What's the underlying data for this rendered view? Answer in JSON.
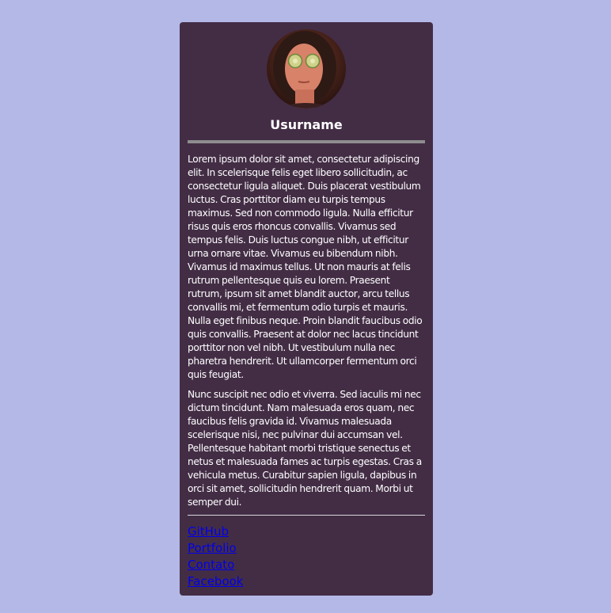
{
  "profile": {
    "username": "Usurname",
    "avatar_icon": "avatar-photo-cucumber-eyes",
    "bio": [
      "Lorem ipsum dolor sit amet, consectetur adipiscing elit. In scelerisque felis eget libero sollicitudin, ac consectetur ligula aliquet. Duis placerat vestibulum luctus. Cras porttitor diam eu turpis tempus maximus. Sed non commodo ligula. Nulla efficitur risus quis eros rhoncus convallis. Vivamus sed tempus felis. Duis luctus congue nibh, ut efficitur urna ornare vitae. Vivamus eu bibendum nibh. Vivamus id maximus tellus. Ut non mauris at felis rutrum pellentesque quis eu lorem. Praesent rutrum, ipsum sit amet blandit auctor, arcu tellus convallis mi, et fermentum odio turpis et mauris. Nulla eget finibus neque. Proin blandit faucibus odio quis convallis. Praesent at dolor nec lacus tincidunt porttitor non vel nibh. Ut vestibulum nulla nec pharetra hendrerit. Ut ullamcorper fermentum orci quis feugiat.",
      "Nunc suscipit nec odio et viverra. Sed iaculis mi nec dictum tincidunt. Nam malesuada eros quam, nec faucibus felis gravida id. Vivamus malesuada scelerisque nisi, nec pulvinar dui accumsan vel. Pellentesque habitant morbi tristique senectus et netus et malesuada fames ac turpis egestas. Cras a vehicula metus. Curabitur sapien ligula, dapibus in orci sit amet, sollicitudin hendrerit quam. Morbi ut semper dui."
    ],
    "links": [
      {
        "label": "GitHub"
      },
      {
        "label": "Portfolio"
      },
      {
        "label": "Contato"
      },
      {
        "label": "Facebook"
      }
    ]
  },
  "colors": {
    "page_background": "#b3b8e6",
    "card_background": "#432d45",
    "divider": "#8e8e8e",
    "link": "#0000ee",
    "text": "#ffffff"
  }
}
